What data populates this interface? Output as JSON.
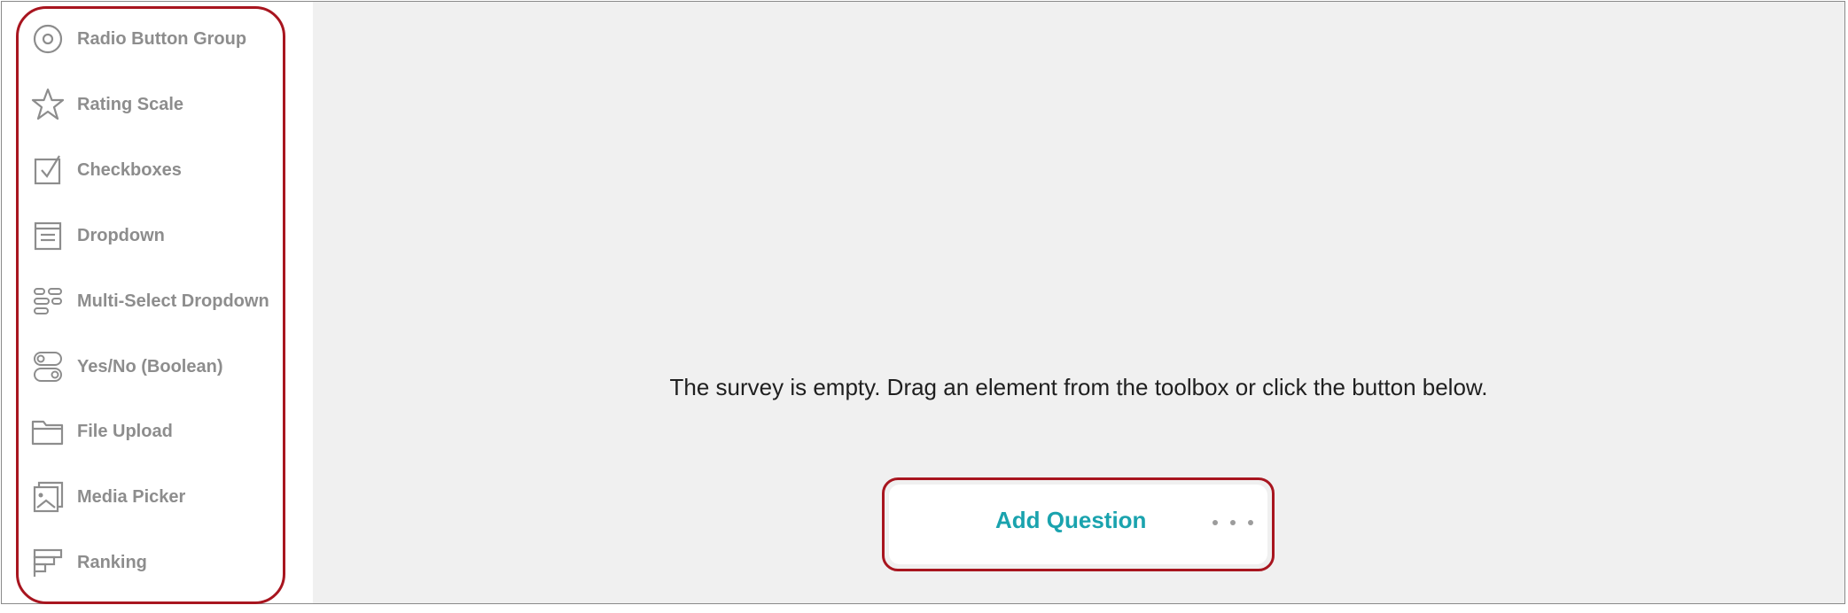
{
  "toolbox": {
    "items": [
      {
        "label": "Radio Button Group",
        "icon": "radio-button-icon"
      },
      {
        "label": "Rating Scale",
        "icon": "star-icon"
      },
      {
        "label": "Checkboxes",
        "icon": "checkbox-icon"
      },
      {
        "label": "Dropdown",
        "icon": "dropdown-icon"
      },
      {
        "label": "Multi-Select Dropdown",
        "icon": "multi-select-icon"
      },
      {
        "label": "Yes/No (Boolean)",
        "icon": "toggle-icon"
      },
      {
        "label": "File Upload",
        "icon": "folder-icon"
      },
      {
        "label": "Media Picker",
        "icon": "image-icon"
      },
      {
        "label": "Ranking",
        "icon": "ranking-icon"
      }
    ],
    "highlight_color": "#a8151f"
  },
  "canvas": {
    "empty_message": "The survey is empty. Drag an element from the toolbox or click the button below.",
    "add_question_label": "Add Question",
    "more_icon": "more-horizontal-icon",
    "accent_color": "#1aa3ae"
  }
}
